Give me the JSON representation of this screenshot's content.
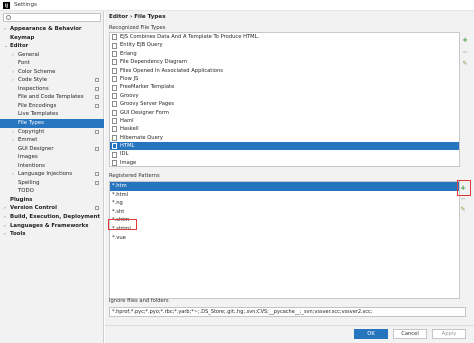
{
  "window": {
    "title": "Settings"
  },
  "left_panel": {
    "search_placeholder": "",
    "tree": [
      {
        "label": "Appearance & Behavior",
        "bold": true,
        "expander": "›",
        "indent": 0
      },
      {
        "label": "Keymap",
        "bold": true,
        "expander": "",
        "indent": 0
      },
      {
        "label": "Editor",
        "bold": true,
        "expander": "⌄",
        "indent": 0
      },
      {
        "label": "General",
        "bold": false,
        "expander": "›",
        "indent": 1
      },
      {
        "label": "Font",
        "bold": false,
        "expander": "",
        "indent": 1
      },
      {
        "label": "Color Scheme",
        "bold": false,
        "expander": "›",
        "indent": 1
      },
      {
        "label": "Code Style",
        "bold": false,
        "expander": "›",
        "indent": 1,
        "page_icon": true
      },
      {
        "label": "Inspections",
        "bold": false,
        "expander": "",
        "indent": 1,
        "page_icon": true
      },
      {
        "label": "File and Code Templates",
        "bold": false,
        "expander": "",
        "indent": 1,
        "page_icon": true
      },
      {
        "label": "File Encodings",
        "bold": false,
        "expander": "",
        "indent": 1,
        "page_icon": true
      },
      {
        "label": "Live Templates",
        "bold": false,
        "expander": "",
        "indent": 1
      },
      {
        "label": "File Types",
        "bold": false,
        "expander": "",
        "indent": 1,
        "selected": true
      },
      {
        "label": "Copyright",
        "bold": false,
        "expander": "›",
        "indent": 1,
        "page_icon": true
      },
      {
        "label": "Emmet",
        "bold": false,
        "expander": "›",
        "indent": 1
      },
      {
        "label": "GUI Designer",
        "bold": false,
        "expander": "",
        "indent": 1,
        "page_icon": true
      },
      {
        "label": "Images",
        "bold": false,
        "expander": "",
        "indent": 1
      },
      {
        "label": "Intentions",
        "bold": false,
        "expander": "",
        "indent": 1
      },
      {
        "label": "Language Injections",
        "bold": false,
        "expander": "›",
        "indent": 1,
        "page_icon": true
      },
      {
        "label": "Spelling",
        "bold": false,
        "expander": "",
        "indent": 1,
        "page_icon": true
      },
      {
        "label": "TODO",
        "bold": false,
        "expander": "",
        "indent": 1
      },
      {
        "label": "Plugins",
        "bold": true,
        "expander": "",
        "indent": 0
      },
      {
        "label": "Version Control",
        "bold": true,
        "expander": "›",
        "indent": 0,
        "page_icon": true
      },
      {
        "label": "Build, Execution, Deployment",
        "bold": true,
        "expander": "›",
        "indent": 0
      },
      {
        "label": "Languages & Frameworks",
        "bold": true,
        "expander": "›",
        "indent": 0
      },
      {
        "label": "Tools",
        "bold": true,
        "expander": "›",
        "indent": 0
      }
    ]
  },
  "main": {
    "breadcrumb": "Editor › File Types",
    "recognized_label": "Recognized File Types",
    "file_types": [
      {
        "label": "EJS Combines Data And A Template To Produce HTML."
      },
      {
        "label": "Entity EJB Query"
      },
      {
        "label": "Erlang"
      },
      {
        "label": "File Dependency Diagram"
      },
      {
        "label": "Files Opened In Associated Applications"
      },
      {
        "label": "Flow JS"
      },
      {
        "label": "FreeMarker Template"
      },
      {
        "label": "Groovy"
      },
      {
        "label": "Groovy Server Pages"
      },
      {
        "label": "GUI Designer Form"
      },
      {
        "label": "Haml"
      },
      {
        "label": "Haskell"
      },
      {
        "label": "Hibernate Query"
      },
      {
        "label": "HTML",
        "selected": true
      },
      {
        "label": "IDL"
      },
      {
        "label": "Image"
      }
    ],
    "registered_label": "Registered Patterns",
    "patterns": [
      {
        "label": "*.htm",
        "selected": true
      },
      {
        "label": "*.html"
      },
      {
        "label": "*.ng"
      },
      {
        "label": "*.sht"
      },
      {
        "label": "*.shtm"
      },
      {
        "label": "*.shtml"
      },
      {
        "label": "*.vue"
      }
    ],
    "ignore_label": "Ignore files and folders",
    "ignore_value": "*.hprof;*.pyc;*.pyo;*.rbc;*.yarb;*~;.DS_Store;.git;.hg;.svn;CVS;__pycache__;_svn;vssver.scc;vssver2.scc;",
    "buttons": {
      "ok": "OK",
      "cancel": "Cancel",
      "apply": "Apply"
    },
    "toolbar": {
      "add": "+",
      "remove": "−",
      "edit": "✎"
    },
    "accent_color": "#2675bf",
    "highlight_color": "#e03a3a"
  }
}
